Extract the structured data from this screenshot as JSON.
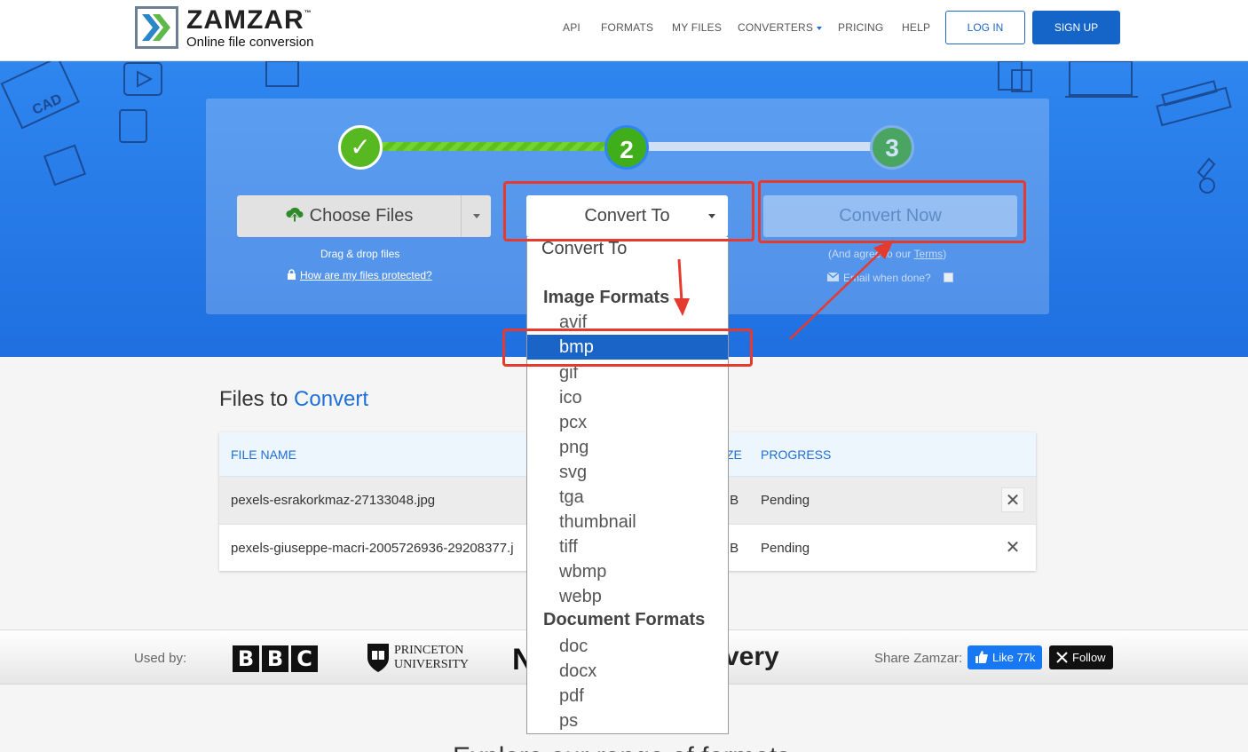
{
  "header": {
    "brand": "ZAMZAR",
    "trademark": "™",
    "tagline": "Online file conversion",
    "nav": [
      "API",
      "FORMATS",
      "MY FILES",
      "CONVERTERS",
      "PRICING",
      "HELP"
    ],
    "login": "LOG IN",
    "signup": "SIGN UP"
  },
  "steps": {
    "step1_symbol": "✓",
    "step2": "2",
    "step3": "3"
  },
  "converter": {
    "choose_files": "Choose Files",
    "drag_drop": "Drag & drop files",
    "protected_link": "How are my files protected?",
    "convert_to": "Convert To",
    "convert_now": "Convert Now",
    "terms_prefix": "(And agree to our ",
    "terms_link": "Terms",
    "terms_suffix": ")",
    "email_label": "Email when done?"
  },
  "dropdown": {
    "placeholder": "Convert To",
    "groups": [
      {
        "label": "Image Formats",
        "options": [
          "avif",
          "bmp",
          "gif",
          "ico",
          "pcx",
          "png",
          "svg",
          "tga",
          "thumbnail",
          "tiff",
          "wbmp",
          "webp"
        ]
      },
      {
        "label": "Document Formats",
        "options": [
          "doc",
          "docx",
          "pdf",
          "ps"
        ]
      }
    ],
    "selected": "bmp"
  },
  "files": {
    "title_prefix": "Files to ",
    "title_highlight": "Convert",
    "columns": [
      "FILE NAME",
      "ZE",
      "PROGRESS"
    ],
    "rows": [
      {
        "name": "pexels-esrakorkmaz-27133048.jpg",
        "size": "IB",
        "progress": "Pending"
      },
      {
        "name": "pexels-giuseppe-macri-2005726936-29208377.j",
        "size": "IB",
        "progress": "Pending"
      }
    ],
    "remove_symbol": "✕"
  },
  "usedby": {
    "label": "Used by:",
    "bbc": [
      "B",
      "B",
      "C"
    ],
    "princeton_line1": "PRINCETON",
    "princeton_line2": "UNIVERSITY",
    "n_logo": "N",
    "discovery": "very",
    "share_label": "Share Zamzar:",
    "like": "Like 77k",
    "follow": "Follow"
  },
  "bottom_heading": "Explore our range of formats",
  "colors": {
    "accent": "#1e6fd9",
    "progress_green": "#6fd22b",
    "annotation_red": "#e53a2e"
  }
}
